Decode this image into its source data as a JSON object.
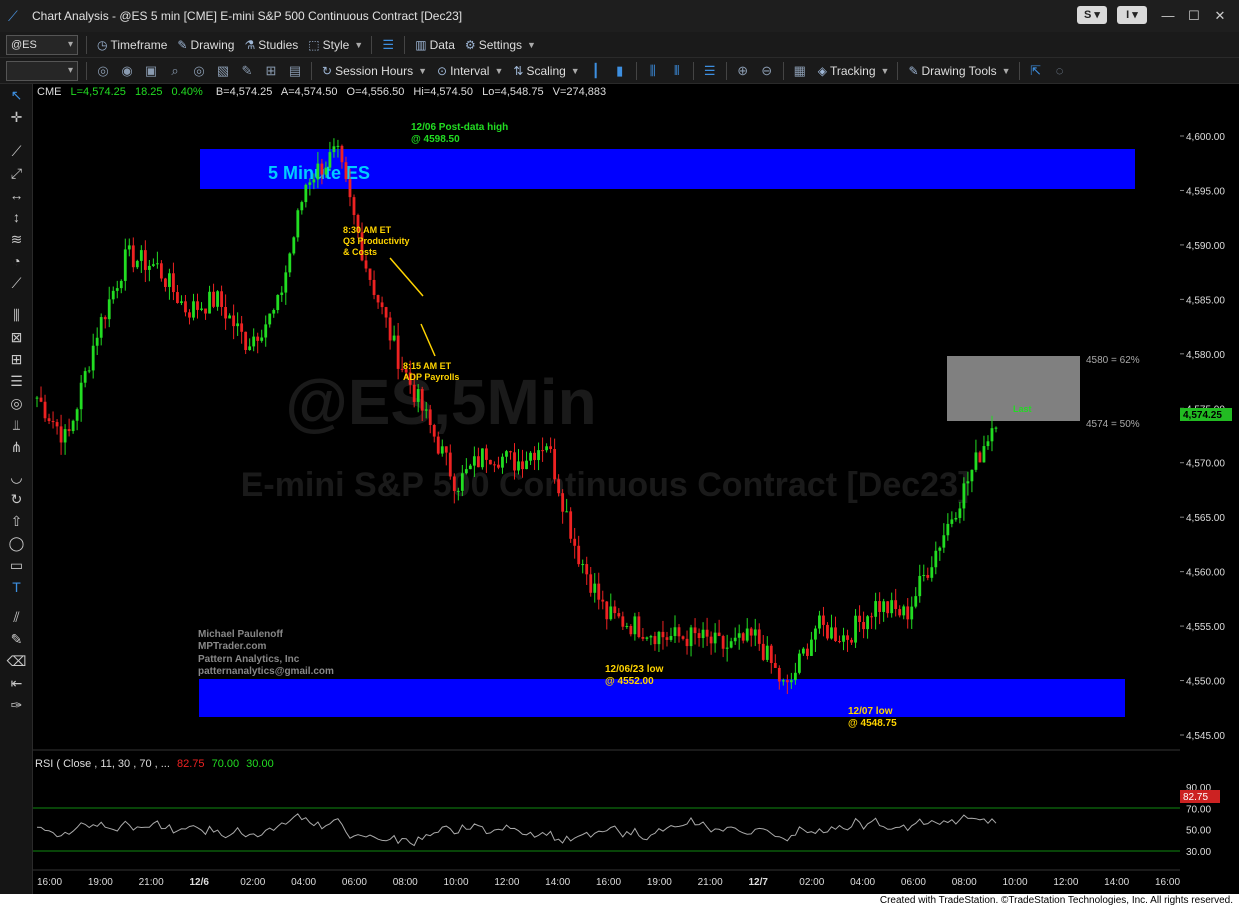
{
  "window": {
    "app_name": "Chart Analysis",
    "title": "Chart Analysis - @ES 5 min [CME] E-mini S&P 500 Continuous Contract [Dec23]",
    "pill1": "S ▾",
    "pill2": "I ▾",
    "min": "—",
    "max": "☐",
    "close": "✕"
  },
  "toolbar1": {
    "symbol": "@ES",
    "timeframe": "Timeframe",
    "drawing": "Drawing",
    "studies": "Studies",
    "style": "Style",
    "data": "Data",
    "settings": "Settings"
  },
  "toolbar2": {
    "combo_value": "",
    "session_hours": "Session Hours",
    "interval": "Interval",
    "scaling": "Scaling",
    "tracking": "Tracking",
    "drawing_tools": "Drawing Tools"
  },
  "chart_header": {
    "exchange": "CME",
    "l": "L=4,574.25",
    "chg": "18.25",
    "pct": "0.40%",
    "b": "B=4,574.25",
    "a": "A=4,574.50",
    "o": "O=4,556.50",
    "hi": "Hi=4,574.50",
    "lo": "Lo=4,548.75",
    "v": "V=274,883"
  },
  "watermark": {
    "symbol": "@ES,5Min",
    "name": "E-mini S&P 500 Continuous Contract [Dec23]"
  },
  "annotations": {
    "banner": "5 Minute ES",
    "high_line1": "12/06 Post-data high",
    "high_line2": "@ 4598.50",
    "q3_line1": "8:30 AM ET",
    "q3_line2": "Q3 Productivity",
    "q3_line3": "& Costs",
    "adp_line1": "8:15 AM ET",
    "adp_line2": "ADP Payrolls",
    "low1_line1": "12/06/23 low",
    "low1_line2": "@ 4552.00",
    "low2_line1": "12/07 low",
    "low2_line2": "@ 4548.75",
    "last": "Last",
    "level62": "4580 = 62%",
    "level50": "4574 = 50%",
    "author1": "Michael Paulenoff",
    "author2": "MPTrader.com",
    "author3": "Pattern Analytics, Inc",
    "author4": "patternanalytics@gmail.com"
  },
  "price_axis": {
    "labels": [
      "4,600.00",
      "4,595.00",
      "4,590.00",
      "4,585.00",
      "4,580.00",
      "4,575.00",
      "4,570.00",
      "4,565.00",
      "4,560.00",
      "4,555.00",
      "4,550.00",
      "4,545.00"
    ],
    "last_price": "4,574.25"
  },
  "rsi": {
    "label": "RSI ( Close , 11, 30 , 70 , ...",
    "v1": "82.75",
    "v2": "70.00",
    "v3": "30.00",
    "axis": [
      "90.00",
      "70.00",
      "50.00",
      "30.00"
    ],
    "current": "82.75"
  },
  "time_axis": [
    "16:00",
    "19:00",
    "21:00",
    "12/6",
    "02:00",
    "04:00",
    "06:00",
    "08:00",
    "10:00",
    "12:00",
    "14:00",
    "16:00",
    "19:00",
    "21:00",
    "12/7",
    "02:00",
    "04:00",
    "06:00",
    "08:00",
    "10:00",
    "12:00",
    "14:00",
    "16:00"
  ],
  "footer": "Created with TradeStation. ©TradeStation Technologies, Inc. All rights reserved.",
  "colors": {
    "up": "#22dd22",
    "down": "#ee2222",
    "banner": "#0000ff",
    "accent": "#3d8fe0"
  },
  "chart_data": {
    "type": "line",
    "title": "@ES 5 min",
    "ylim": [
      4544,
      4602
    ],
    "x": [
      "16:00",
      "19:00",
      "21:00",
      "12/6 00:00",
      "02:00",
      "04:00",
      "06:00",
      "07:30",
      "08:15",
      "08:30",
      "09:00",
      "09:30",
      "10:00",
      "10:30",
      "11:00",
      "12:00",
      "13:00",
      "14:00",
      "15:00",
      "16:00",
      "19:00",
      "21:00",
      "12/7 00:00",
      "02:00",
      "04:00",
      "04:30",
      "05:00",
      "06:00",
      "07:00",
      "08:00",
      "08:30",
      "09:00",
      "09:30"
    ],
    "series": [
      {
        "values": [
          4576,
          4572,
          4582,
          4589,
          4588,
          4584,
          4585,
          4581,
          4584,
          4596,
          4598.5,
          4588,
          4580,
          4574,
          4568,
          4571,
          4570,
          4572,
          4562,
          4556,
          4555,
          4554,
          4554,
          4553,
          4554,
          4549,
          4555,
          4554,
          4557,
          4556,
          4562,
          4568,
          4574.25
        ]
      }
    ]
  }
}
